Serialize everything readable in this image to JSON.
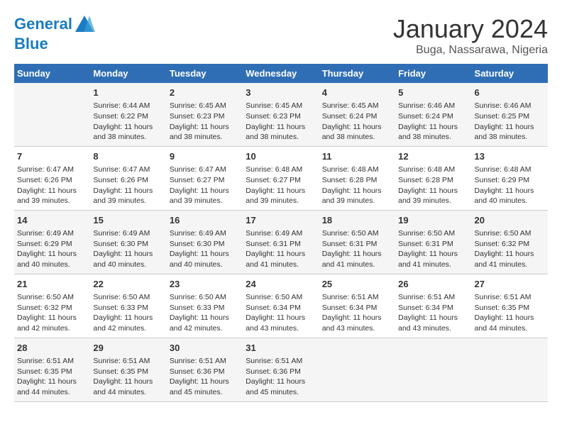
{
  "header": {
    "logo_line1": "General",
    "logo_line2": "Blue",
    "title": "January 2024",
    "subtitle": "Buga, Nassarawa, Nigeria"
  },
  "weekdays": [
    "Sunday",
    "Monday",
    "Tuesday",
    "Wednesday",
    "Thursday",
    "Friday",
    "Saturday"
  ],
  "weeks": [
    [
      {
        "day": "",
        "info": ""
      },
      {
        "day": "1",
        "info": "Sunrise: 6:44 AM\nSunset: 6:22 PM\nDaylight: 11 hours\nand 38 minutes."
      },
      {
        "day": "2",
        "info": "Sunrise: 6:45 AM\nSunset: 6:23 PM\nDaylight: 11 hours\nand 38 minutes."
      },
      {
        "day": "3",
        "info": "Sunrise: 6:45 AM\nSunset: 6:23 PM\nDaylight: 11 hours\nand 38 minutes."
      },
      {
        "day": "4",
        "info": "Sunrise: 6:45 AM\nSunset: 6:24 PM\nDaylight: 11 hours\nand 38 minutes."
      },
      {
        "day": "5",
        "info": "Sunrise: 6:46 AM\nSunset: 6:24 PM\nDaylight: 11 hours\nand 38 minutes."
      },
      {
        "day": "6",
        "info": "Sunrise: 6:46 AM\nSunset: 6:25 PM\nDaylight: 11 hours\nand 38 minutes."
      }
    ],
    [
      {
        "day": "7",
        "info": "Sunrise: 6:47 AM\nSunset: 6:26 PM\nDaylight: 11 hours\nand 39 minutes."
      },
      {
        "day": "8",
        "info": "Sunrise: 6:47 AM\nSunset: 6:26 PM\nDaylight: 11 hours\nand 39 minutes."
      },
      {
        "day": "9",
        "info": "Sunrise: 6:47 AM\nSunset: 6:27 PM\nDaylight: 11 hours\nand 39 minutes."
      },
      {
        "day": "10",
        "info": "Sunrise: 6:48 AM\nSunset: 6:27 PM\nDaylight: 11 hours\nand 39 minutes."
      },
      {
        "day": "11",
        "info": "Sunrise: 6:48 AM\nSunset: 6:28 PM\nDaylight: 11 hours\nand 39 minutes."
      },
      {
        "day": "12",
        "info": "Sunrise: 6:48 AM\nSunset: 6:28 PM\nDaylight: 11 hours\nand 39 minutes."
      },
      {
        "day": "13",
        "info": "Sunrise: 6:48 AM\nSunset: 6:29 PM\nDaylight: 11 hours\nand 40 minutes."
      }
    ],
    [
      {
        "day": "14",
        "info": "Sunrise: 6:49 AM\nSunset: 6:29 PM\nDaylight: 11 hours\nand 40 minutes."
      },
      {
        "day": "15",
        "info": "Sunrise: 6:49 AM\nSunset: 6:30 PM\nDaylight: 11 hours\nand 40 minutes."
      },
      {
        "day": "16",
        "info": "Sunrise: 6:49 AM\nSunset: 6:30 PM\nDaylight: 11 hours\nand 40 minutes."
      },
      {
        "day": "17",
        "info": "Sunrise: 6:49 AM\nSunset: 6:31 PM\nDaylight: 11 hours\nand 41 minutes."
      },
      {
        "day": "18",
        "info": "Sunrise: 6:50 AM\nSunset: 6:31 PM\nDaylight: 11 hours\nand 41 minutes."
      },
      {
        "day": "19",
        "info": "Sunrise: 6:50 AM\nSunset: 6:31 PM\nDaylight: 11 hours\nand 41 minutes."
      },
      {
        "day": "20",
        "info": "Sunrise: 6:50 AM\nSunset: 6:32 PM\nDaylight: 11 hours\nand 41 minutes."
      }
    ],
    [
      {
        "day": "21",
        "info": "Sunrise: 6:50 AM\nSunset: 6:32 PM\nDaylight: 11 hours\nand 42 minutes."
      },
      {
        "day": "22",
        "info": "Sunrise: 6:50 AM\nSunset: 6:33 PM\nDaylight: 11 hours\nand 42 minutes."
      },
      {
        "day": "23",
        "info": "Sunrise: 6:50 AM\nSunset: 6:33 PM\nDaylight: 11 hours\nand 42 minutes."
      },
      {
        "day": "24",
        "info": "Sunrise: 6:50 AM\nSunset: 6:34 PM\nDaylight: 11 hours\nand 43 minutes."
      },
      {
        "day": "25",
        "info": "Sunrise: 6:51 AM\nSunset: 6:34 PM\nDaylight: 11 hours\nand 43 minutes."
      },
      {
        "day": "26",
        "info": "Sunrise: 6:51 AM\nSunset: 6:34 PM\nDaylight: 11 hours\nand 43 minutes."
      },
      {
        "day": "27",
        "info": "Sunrise: 6:51 AM\nSunset: 6:35 PM\nDaylight: 11 hours\nand 44 minutes."
      }
    ],
    [
      {
        "day": "28",
        "info": "Sunrise: 6:51 AM\nSunset: 6:35 PM\nDaylight: 11 hours\nand 44 minutes."
      },
      {
        "day": "29",
        "info": "Sunrise: 6:51 AM\nSunset: 6:35 PM\nDaylight: 11 hours\nand 44 minutes."
      },
      {
        "day": "30",
        "info": "Sunrise: 6:51 AM\nSunset: 6:36 PM\nDaylight: 11 hours\nand 45 minutes."
      },
      {
        "day": "31",
        "info": "Sunrise: 6:51 AM\nSunset: 6:36 PM\nDaylight: 11 hours\nand 45 minutes."
      },
      {
        "day": "",
        "info": ""
      },
      {
        "day": "",
        "info": ""
      },
      {
        "day": "",
        "info": ""
      }
    ]
  ]
}
